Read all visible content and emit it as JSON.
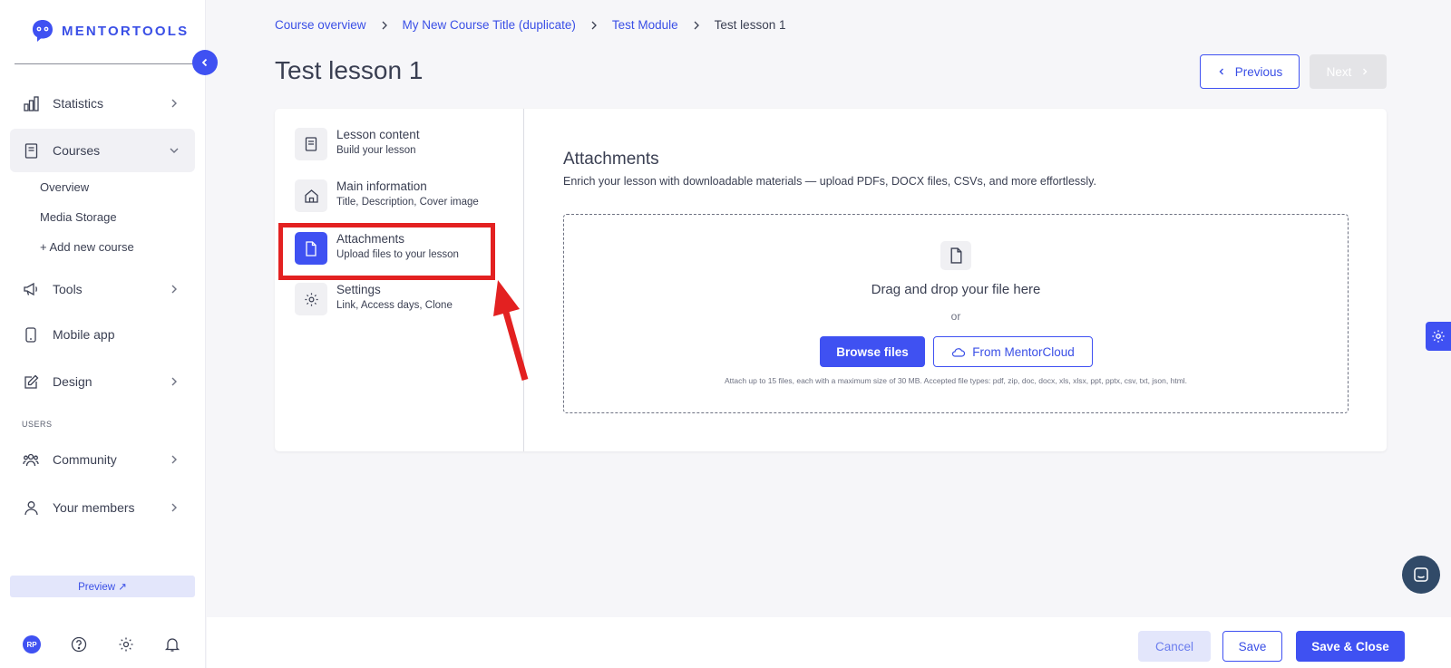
{
  "app": {
    "logo_text": "MENTORTOOLS",
    "accent": "#3f51f2"
  },
  "sidebar": {
    "items": [
      {
        "label": "Statistics",
        "icon": "bar-chart-icon"
      },
      {
        "label": "Courses",
        "icon": "book-icon",
        "expanded": true
      },
      {
        "label": "Tools",
        "icon": "megaphone-icon"
      },
      {
        "label": "Mobile app",
        "icon": "phone-icon"
      },
      {
        "label": "Design",
        "icon": "pencil-icon"
      },
      {
        "label": "Community",
        "icon": "users-icon"
      },
      {
        "label": "Your members",
        "icon": "user-icon"
      }
    ],
    "courses_sub": [
      "Overview",
      "Media Storage",
      "+ Add new course"
    ],
    "section_users": "USERS",
    "preview_label": "Preview ↗",
    "avatar_initials": "RP"
  },
  "breadcrumb": {
    "items": [
      "Course overview",
      "My New Course Title (duplicate)",
      "Test Module"
    ],
    "current": "Test lesson 1"
  },
  "page": {
    "title": "Test lesson 1",
    "previous_label": "Previous",
    "next_label": "Next"
  },
  "steps": [
    {
      "title": "Lesson content",
      "subtitle": "Build your lesson",
      "icon": "book-icon"
    },
    {
      "title": "Main information",
      "subtitle": "Title, Description, Cover image",
      "icon": "home-icon"
    },
    {
      "title": "Attachments",
      "subtitle": "Upload files to your lesson",
      "icon": "file-icon",
      "active": true
    },
    {
      "title": "Settings",
      "subtitle": "Link, Access days, Clone",
      "icon": "gear-icon"
    }
  ],
  "attachments": {
    "title": "Attachments",
    "description": "Enrich your lesson with downloadable materials — upload PDFs, DOCX files, CSVs, and more effortlessly.",
    "drop_text": "Drag and drop your file here",
    "or_text": "or",
    "browse_label": "Browse files",
    "cloud_label": "From MentorCloud",
    "note": "Attach up to 15 files, each with a maximum size of 30 MB. Accepted file types: pdf, zip, doc, docx, xls, xlsx, ppt, pptx, csv, txt, json, html."
  },
  "footer": {
    "cancel_label": "Cancel",
    "save_label": "Save",
    "save_close_label": "Save & Close"
  }
}
